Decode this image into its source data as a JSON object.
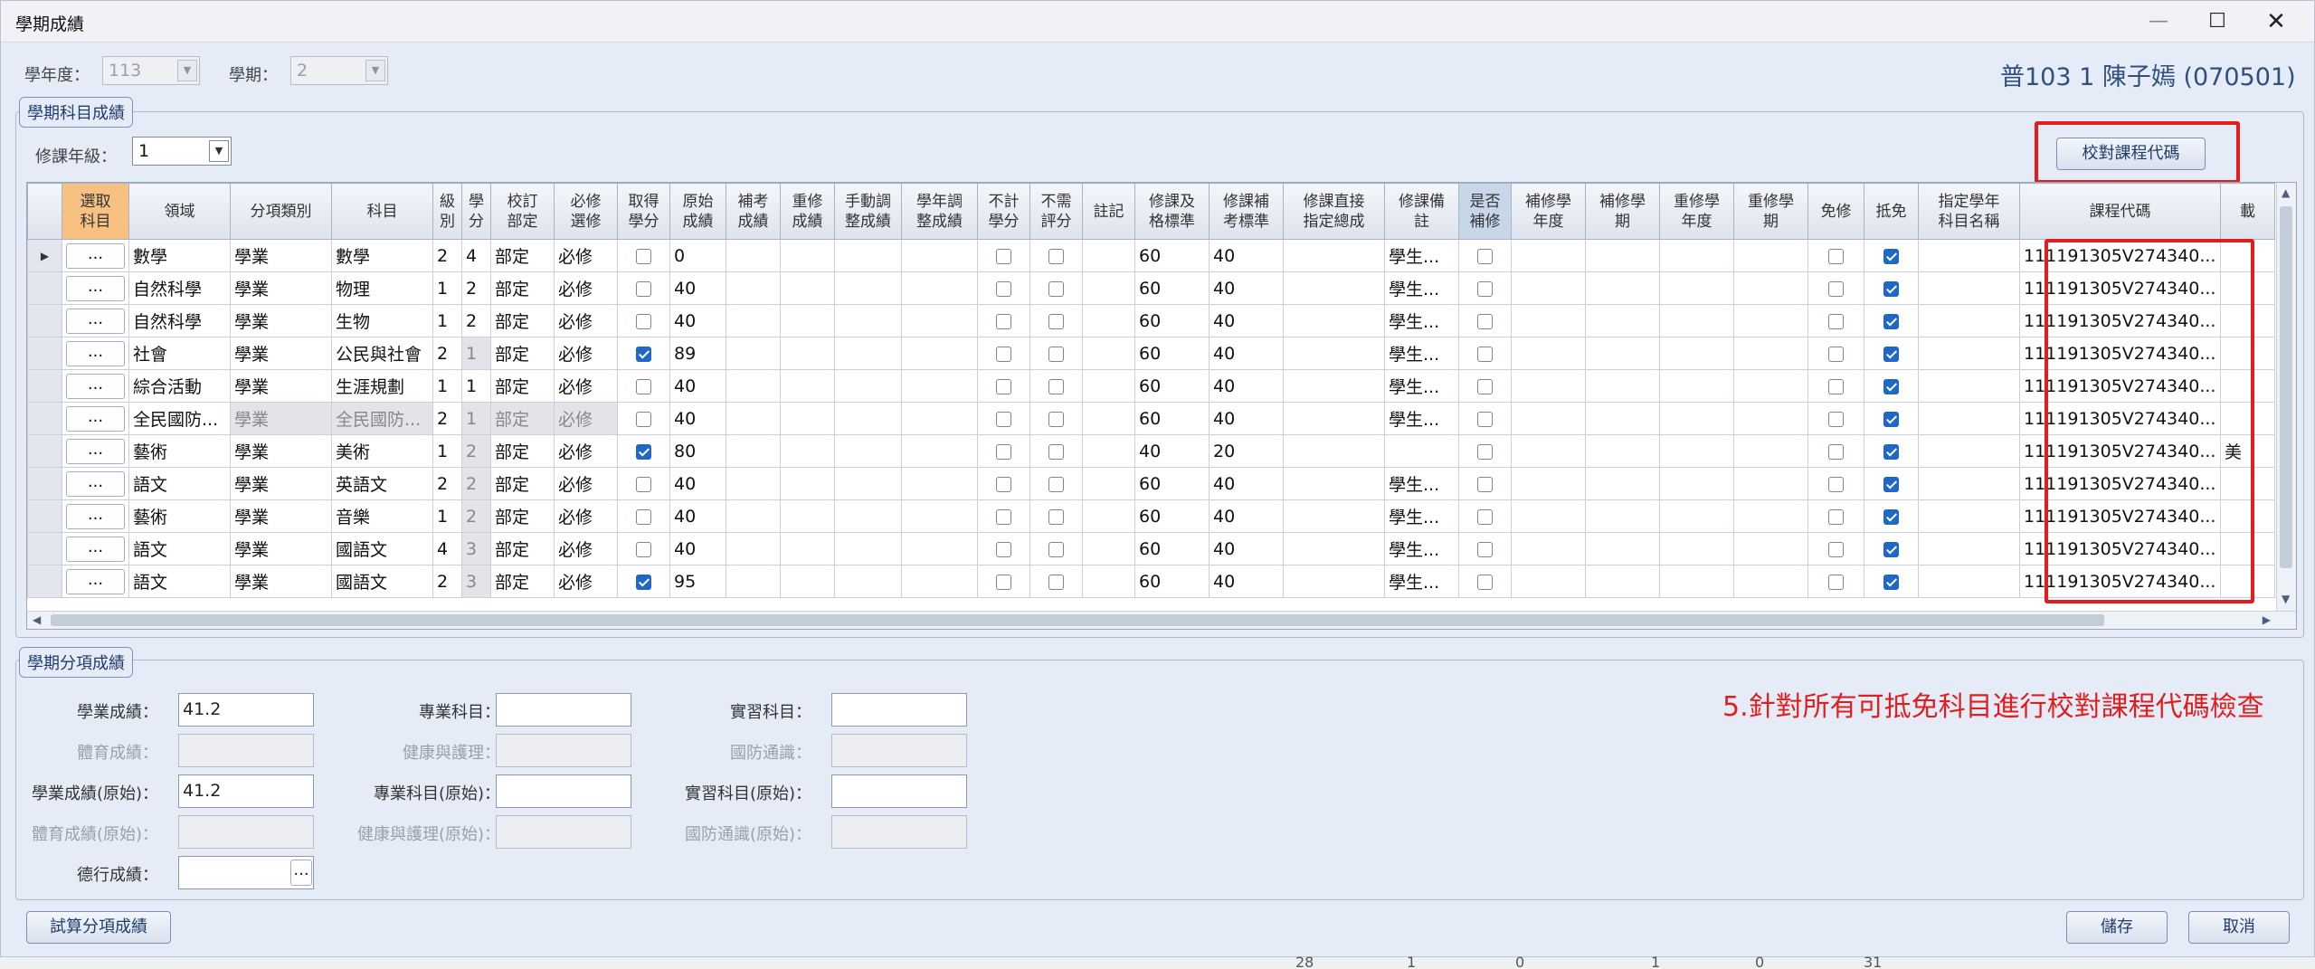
{
  "window": {
    "title": "學期成績"
  },
  "top": {
    "year_label": "學年度：",
    "year_value": "113",
    "term_label": "學期：",
    "term_value": "2",
    "student": "普103 1 陳子嫣 (070501)"
  },
  "subject_group": {
    "legend": "學期科目成績",
    "grade_label": "修課年級：",
    "grade_value": "1",
    "check_button": "校對課程代碼"
  },
  "grid": {
    "headers": [
      "",
      "選取\n科目",
      "領域",
      "分項類別",
      "科目",
      "級\n別",
      "學\n分",
      "校訂\n部定",
      "必修\n選修",
      "取得\n學分",
      "原始\n成績",
      "補考\n成績",
      "重修\n成績",
      "手動調\n整成績",
      "學年調\n整成績",
      "不計\n學分",
      "不需\n評分",
      "註記",
      "修課及\n格標準",
      "修課補\n考標準",
      "修課直接\n指定總成",
      "修課備\n註",
      "是否\n補修",
      "補修學\n年度",
      "補修學\n期",
      "重修學\n年度",
      "重修學\n期",
      "免修",
      "抵免",
      "指定學年\n科目名稱",
      "課程代碼",
      "載"
    ],
    "rows": [
      {
        "domain": "數學",
        "cat": "學業",
        "subject": "數學",
        "level": "2",
        "credit": "4",
        "school": "部定",
        "req": "必修",
        "got": false,
        "raw": "0",
        "pass": "60",
        "makeup": "40",
        "note": "學生...",
        "code": "111191305V274340...",
        "gray": false
      },
      {
        "domain": "自然科學",
        "cat": "學業",
        "subject": "物理",
        "level": "1",
        "credit": "2",
        "school": "部定",
        "req": "必修",
        "got": false,
        "raw": "40",
        "pass": "60",
        "makeup": "40",
        "note": "學生...",
        "code": "111191305V274340...",
        "gray": false
      },
      {
        "domain": "自然科學",
        "cat": "學業",
        "subject": "生物",
        "level": "1",
        "credit": "2",
        "school": "部定",
        "req": "必修",
        "got": false,
        "raw": "40",
        "pass": "60",
        "makeup": "40",
        "note": "學生...",
        "code": "111191305V274340...",
        "gray": false
      },
      {
        "domain": "社會",
        "cat": "學業",
        "subject": "公民與社會",
        "level": "2",
        "credit": "1",
        "school": "部定",
        "req": "必修",
        "got": true,
        "raw": "89",
        "pass": "60",
        "makeup": "40",
        "note": "學生...",
        "code": "111191305V274340...",
        "gray": false,
        "creditGray": true
      },
      {
        "domain": "綜合活動",
        "cat": "學業",
        "subject": "生涯規劃",
        "level": "1",
        "credit": "1",
        "school": "部定",
        "req": "必修",
        "got": false,
        "raw": "40",
        "pass": "60",
        "makeup": "40",
        "note": "學生...",
        "code": "111191305V274340...",
        "gray": false
      },
      {
        "domain": "全民國防...",
        "cat": "學業",
        "subject": "全民國防...",
        "level": "2",
        "credit": "1",
        "school": "部定",
        "req": "必修",
        "got": false,
        "raw": "40",
        "pass": "60",
        "makeup": "40",
        "note": "學生...",
        "code": "111191305V274340...",
        "gray": true
      },
      {
        "domain": "藝術",
        "cat": "學業",
        "subject": "美術",
        "level": "1",
        "credit": "2",
        "school": "部定",
        "req": "必修",
        "got": true,
        "raw": "80",
        "pass": "40",
        "makeup": "20",
        "note": "",
        "code": "111191305V274340...",
        "gray": false,
        "creditGray": true,
        "extra": "美"
      },
      {
        "domain": "語文",
        "cat": "學業",
        "subject": "英語文",
        "level": "2",
        "credit": "2",
        "school": "部定",
        "req": "必修",
        "got": false,
        "raw": "40",
        "pass": "60",
        "makeup": "40",
        "note": "學生...",
        "code": "111191305V274340...",
        "gray": false,
        "creditGray": true
      },
      {
        "domain": "藝術",
        "cat": "學業",
        "subject": "音樂",
        "level": "1",
        "credit": "2",
        "school": "部定",
        "req": "必修",
        "got": false,
        "raw": "40",
        "pass": "60",
        "makeup": "40",
        "note": "學生...",
        "code": "111191305V274340...",
        "gray": false,
        "creditGray": true
      },
      {
        "domain": "語文",
        "cat": "學業",
        "subject": "國語文",
        "level": "4",
        "credit": "3",
        "school": "部定",
        "req": "必修",
        "got": false,
        "raw": "40",
        "pass": "60",
        "makeup": "40",
        "note": "學生...",
        "code": "111191305V274340...",
        "gray": false,
        "creditGray": true
      },
      {
        "domain": "語文",
        "cat": "學業",
        "subject": "國語文",
        "level": "2",
        "credit": "3",
        "school": "部定",
        "req": "必修",
        "got": true,
        "raw": "95",
        "pass": "60",
        "makeup": "40",
        "note": "學生...",
        "code": "111191305V274340...",
        "gray": false,
        "creditGray": true
      }
    ],
    "dots_label": "..."
  },
  "item_group": {
    "legend": "學期分項成績",
    "academic_label": "學業成績：",
    "academic_value": "41.2",
    "pe_label": "體育成績：",
    "academic_raw_label": "學業成績(原始)：",
    "academic_raw_value": "41.2",
    "pe_raw_label": "體育成績(原始)：",
    "conduct_label": "德行成績：",
    "major_label": "專業科目：",
    "health_label": "健康與護理：",
    "major_raw_label": "專業科目(原始)：",
    "health_raw_label": "健康與護理(原始)：",
    "practice_label": "實習科目：",
    "defense_label": "國防通識：",
    "practice_raw_label": "實習科目(原始)：",
    "defense_raw_label": "國防通識(原始)：",
    "conduct_button": "..."
  },
  "annotation": "5.針對所有可抵免科目進行校對課程代碼檢查",
  "footer": {
    "calc_button": "試算分項成績",
    "save_button": "儲存",
    "cancel_button": "取消"
  },
  "background_numbers": [
    "28",
    "1",
    "0",
    "1",
    "0",
    "31"
  ],
  "colors": {
    "annotation": "#e21d1d",
    "accent": "#1f68c8",
    "header_orange": "#f7c281"
  }
}
